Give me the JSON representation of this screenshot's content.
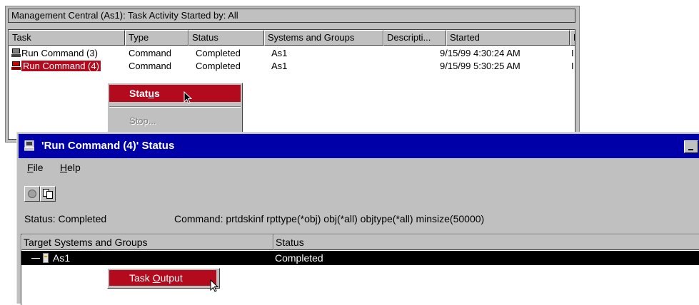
{
  "task_window": {
    "title": "Management Central (As1):  Task Activity   Started by:  All",
    "columns": [
      "Task",
      "Type",
      "Status",
      "Systems and Groups",
      "Descripti...",
      "Started",
      "E"
    ],
    "rows": [
      {
        "task": "Run Command (3)",
        "type": "Command",
        "status": "Completed",
        "systems": "As1",
        "started": "9/15/99 4:30:24 AM",
        "extra": "I"
      },
      {
        "task": "Run Command (4)",
        "type": "Command",
        "status": "Completed",
        "systems": "As1",
        "started": "9/15/99 5:30:25 AM",
        "extra": "I"
      }
    ],
    "context_menu": {
      "status_label": "Status",
      "status_mnemonic": "u",
      "stop_label": "Stop..."
    }
  },
  "status_window": {
    "title": "'Run Command (4)' Status",
    "menu": [
      {
        "label": "File",
        "mnemonic": "F"
      },
      {
        "label": "Help",
        "mnemonic": "H"
      }
    ],
    "toolbar": [
      {
        "icon": "stop-icon"
      },
      {
        "icon": "copy-icon"
      }
    ],
    "status_text": "Status: Completed",
    "command_text": "Command: prtdskinf rpttype(*obj) obj(*all) objtype(*all) minsize(50000)",
    "table": {
      "columns": [
        "Target Systems and Groups",
        "Status"
      ],
      "rows": [
        {
          "name": "As1",
          "status": "Completed"
        }
      ]
    },
    "context_menu": {
      "task_output_label": "Task Output",
      "mnemonic": "O"
    }
  },
  "colors": {
    "title_bar": "#0000a8",
    "selection_red": "#b40a1e",
    "window_face": "#c0c0c0"
  }
}
